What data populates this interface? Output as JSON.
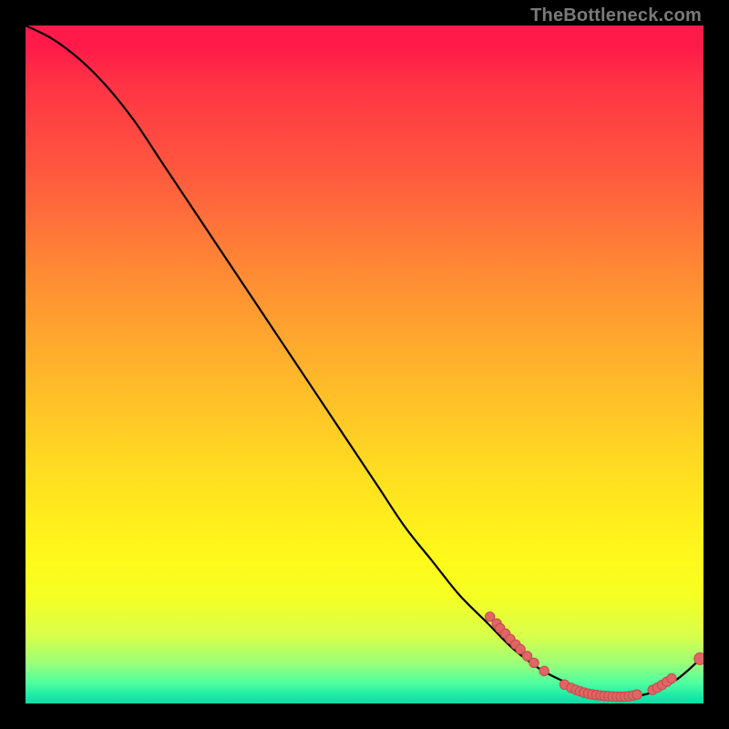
{
  "attribution": "TheBottleneck.com",
  "colors": {
    "point_fill": "#e06666",
    "point_stroke": "#c44b4b",
    "curve": "#000000"
  },
  "chart_data": {
    "type": "line",
    "title": "",
    "xlabel": "",
    "ylabel": "",
    "xlim": [
      0,
      100
    ],
    "ylim": [
      0,
      100
    ],
    "grid": false,
    "series": [
      {
        "name": "bottleneck-curve",
        "x": [
          0,
          4,
          8,
          12,
          16,
          20,
          24,
          28,
          32,
          36,
          40,
          44,
          48,
          52,
          56,
          60,
          64,
          68,
          72,
          76,
          80,
          84,
          88,
          92,
          96,
          100
        ],
        "y": [
          100,
          98,
          95,
          91,
          86,
          80,
          74,
          68,
          62,
          56,
          50,
          44,
          38,
          32,
          26,
          21,
          16,
          12,
          8,
          5,
          3,
          1.5,
          1,
          1.5,
          3.5,
          7
        ]
      }
    ],
    "points": [
      {
        "x": 68.5,
        "y": 12.8
      },
      {
        "x": 69.5,
        "y": 11.8
      },
      {
        "x": 70.0,
        "y": 11.1
      },
      {
        "x": 70.8,
        "y": 10.3
      },
      {
        "x": 71.5,
        "y": 9.5
      },
      {
        "x": 72.3,
        "y": 8.7
      },
      {
        "x": 73.0,
        "y": 8.0
      },
      {
        "x": 74.0,
        "y": 7.0
      },
      {
        "x": 75.0,
        "y": 6.0
      },
      {
        "x": 76.5,
        "y": 4.8
      },
      {
        "x": 79.5,
        "y": 2.8
      },
      {
        "x": 80.5,
        "y": 2.3
      },
      {
        "x": 81.2,
        "y": 2.0
      },
      {
        "x": 81.8,
        "y": 1.8
      },
      {
        "x": 82.4,
        "y": 1.6
      },
      {
        "x": 83.0,
        "y": 1.45
      },
      {
        "x": 83.6,
        "y": 1.35
      },
      {
        "x": 84.2,
        "y": 1.25
      },
      {
        "x": 84.8,
        "y": 1.18
      },
      {
        "x": 85.4,
        "y": 1.12
      },
      {
        "x": 86.0,
        "y": 1.08
      },
      {
        "x": 86.6,
        "y": 1.05
      },
      {
        "x": 87.2,
        "y": 1.02
      },
      {
        "x": 87.8,
        "y": 1.0
      },
      {
        "x": 88.4,
        "y": 1.02
      },
      {
        "x": 89.0,
        "y": 1.08
      },
      {
        "x": 89.6,
        "y": 1.18
      },
      {
        "x": 90.2,
        "y": 1.32
      },
      {
        "x": 92.5,
        "y": 2.0
      },
      {
        "x": 93.2,
        "y": 2.35
      },
      {
        "x": 93.9,
        "y": 2.75
      },
      {
        "x": 94.6,
        "y": 3.2
      },
      {
        "x": 95.3,
        "y": 3.7
      },
      {
        "x": 99.5,
        "y": 6.6
      }
    ]
  }
}
